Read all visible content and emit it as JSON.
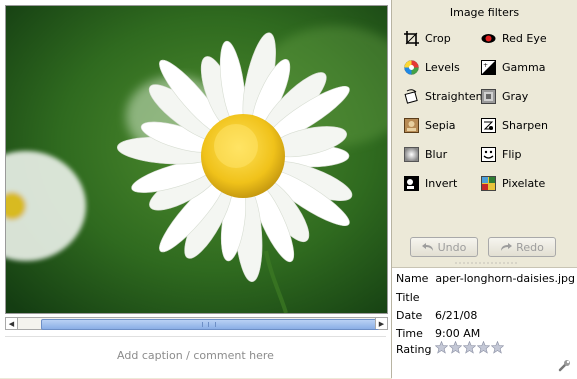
{
  "caption_placeholder": "Add caption / comment here",
  "filters": {
    "title": "Image filters",
    "items": [
      {
        "label": "Crop",
        "icon": "crop-icon"
      },
      {
        "label": "Red Eye",
        "icon": "red-eye-icon"
      },
      {
        "label": "Levels",
        "icon": "levels-icon"
      },
      {
        "label": "Gamma",
        "icon": "gamma-icon"
      },
      {
        "label": "Straighten",
        "icon": "straighten-icon"
      },
      {
        "label": "Gray",
        "icon": "gray-icon"
      },
      {
        "label": "Sepia",
        "icon": "sepia-icon"
      },
      {
        "label": "Sharpen",
        "icon": "sharpen-icon"
      },
      {
        "label": "Blur",
        "icon": "blur-icon"
      },
      {
        "label": "Flip",
        "icon": "flip-icon"
      },
      {
        "label": "Invert",
        "icon": "invert-icon"
      },
      {
        "label": "Pixelate",
        "icon": "pixelate-icon"
      }
    ]
  },
  "actions": {
    "undo_label": "Undo",
    "redo_label": "Redo"
  },
  "metadata": {
    "name_label": "Name",
    "name_value": "paper-longhorn-daisies.jpg",
    "title_label": "Title",
    "title_value": "",
    "date_label": "Date",
    "date_value": "6/21/08",
    "time_label": "Time",
    "time_value": "9:00 AM",
    "rating_label": "Rating",
    "rating_value": 0,
    "rating_max": 5
  },
  "colors": {
    "scroll_thumb": "#8aaee6",
    "panel_bg": "#ece9d8",
    "disabled_text": "#9d9d9d"
  }
}
